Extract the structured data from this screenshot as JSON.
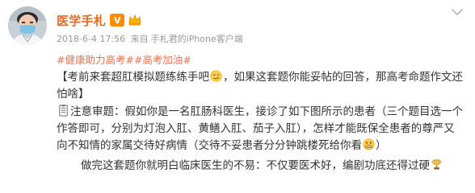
{
  "user": {
    "name": "医学手札",
    "vip_badge_text": "V"
  },
  "meta": {
    "date": "2018-6-4",
    "time": "17:56",
    "source_prefix": "来自",
    "source": "手札君的iPhone客户端"
  },
  "hashtags": [
    "#健康助力高考#",
    "#高考加油#"
  ],
  "paragraphs": {
    "p1_text": "【考前来套超肛模拟题练练手吧",
    "p1_text_after": "，如果这套题你能妥帖的回答，那高考命题作文还怕啥】",
    "p2_text": "注意审题：假如你是一名肛肠科医生，接诊了如下图所示的患者（三个题目选一个作答即可，分别为灯泡入肛、黄鳝入肛、茄子入肛），怎样才能既保全患者的尊严又向不知情的家属交待好病情（交待不妥患者分分钟跳楼死给你看",
    "p2_text_after": "）",
    "p3_text": "做完这套题你就明白临床医生的不易：不仅要医术好，编剧功底还得过硬"
  },
  "icons": {
    "avatar": "avatar-image",
    "vip": "vip-badge",
    "crown": "gold-crown-icon",
    "chevron": "chevron-down-icon",
    "emoji_smirk": "smirk-emoji-icon",
    "emoji_memo": "memo-emoji-icon",
    "emoji_grimace": "grimace-emoji-icon",
    "emoji_trophy": "trophy-emoji-icon"
  },
  "colors": {
    "name": "#e5691e",
    "hashtag": "#eb7350",
    "meta": "#999999",
    "body_text": "#333333"
  }
}
